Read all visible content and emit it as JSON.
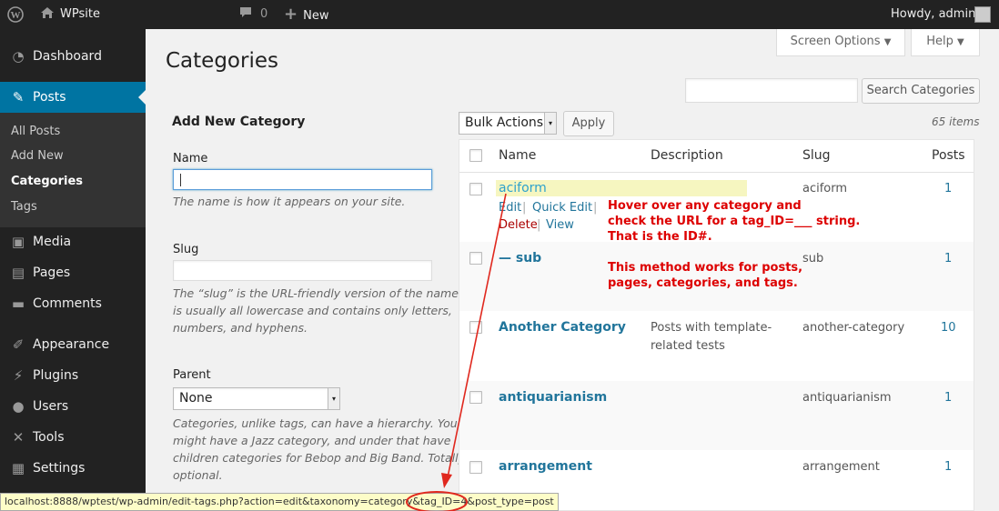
{
  "adminbar": {
    "site_name": "WPsite",
    "comments_count": "0",
    "new_label": "New",
    "howdy": "Howdy, admin"
  },
  "sidebar": {
    "items": [
      {
        "label": "Dashboard",
        "icon": "dashboard-icon"
      },
      {
        "label": "Posts",
        "icon": "pin-icon"
      },
      {
        "label": "Media",
        "icon": "media-icon"
      },
      {
        "label": "Pages",
        "icon": "pages-icon"
      },
      {
        "label": "Comments",
        "icon": "comments-icon"
      },
      {
        "label": "Appearance",
        "icon": "brush-icon"
      },
      {
        "label": "Plugins",
        "icon": "plug-icon"
      },
      {
        "label": "Users",
        "icon": "user-icon"
      },
      {
        "label": "Tools",
        "icon": "wrench-icon"
      },
      {
        "label": "Settings",
        "icon": "settings-icon"
      }
    ],
    "submenu": [
      "All Posts",
      "Add New",
      "Categories",
      "Tags"
    ]
  },
  "header": {
    "title": "Categories",
    "screen_options": "Screen Options",
    "help": "Help",
    "search_button": "Search Categories"
  },
  "form": {
    "heading": "Add New Category",
    "name_label": "Name",
    "name_desc": "The name is how it appears on your site.",
    "slug_label": "Slug",
    "slug_desc_1": "The “slug” is the URL-friendly version of the name. It",
    "slug_desc_2": "is usually all lowercase and contains only letters,",
    "slug_desc_3": "numbers, and hyphens.",
    "parent_label": "Parent",
    "parent_value": "None",
    "parent_desc_1": "Categories, unlike tags, can have a hierarchy. You",
    "parent_desc_2": "might have a Jazz category, and under that have",
    "parent_desc_3": "children categories for Bebop and Big Band. Totally",
    "parent_desc_4": "optional."
  },
  "list": {
    "bulk_actions": "Bulk Actions",
    "apply": "Apply",
    "item_count": "65 items",
    "columns": {
      "name": "Name",
      "description": "Description",
      "slug": "Slug",
      "posts": "Posts"
    },
    "row_actions": {
      "edit": "Edit",
      "quick_edit": "Quick Edit",
      "delete": "Delete",
      "view": "View"
    },
    "rows": [
      {
        "name": "aciform",
        "desc1": "",
        "desc2": "",
        "slug": "aciform",
        "count": "1"
      },
      {
        "name": "— sub",
        "desc1": "",
        "desc2": "",
        "slug": "sub",
        "count": "1"
      },
      {
        "name": "Another Category",
        "desc1": "Posts with template-",
        "desc2": "related tests",
        "slug": "another-category",
        "count": "10"
      },
      {
        "name": "antiquarianism",
        "desc1": "",
        "desc2": "",
        "slug": "antiquarianism",
        "count": "1"
      },
      {
        "name": "arrangement",
        "desc1": "",
        "desc2": "",
        "slug": "arrangement",
        "count": "1"
      }
    ]
  },
  "annotation": {
    "line1": "Hover over any category and",
    "line2": "check the URL for a tag_ID=___ string.",
    "line3": "That is the ID#.",
    "line4": "This method works for posts,",
    "line5": "pages, categories, and tags.",
    "color": "#dd0000"
  },
  "status_bar": {
    "url": "localhost:8888/wptest/wp-admin/edit-tags.php?action=edit&taxonomy=category&tag_ID=4&post_type=post"
  },
  "colors": {
    "adminbar": "#222222",
    "sidebar": "#222222",
    "active": "#0074a2",
    "link": "#21759b",
    "highlight": "#f6f6c0"
  }
}
